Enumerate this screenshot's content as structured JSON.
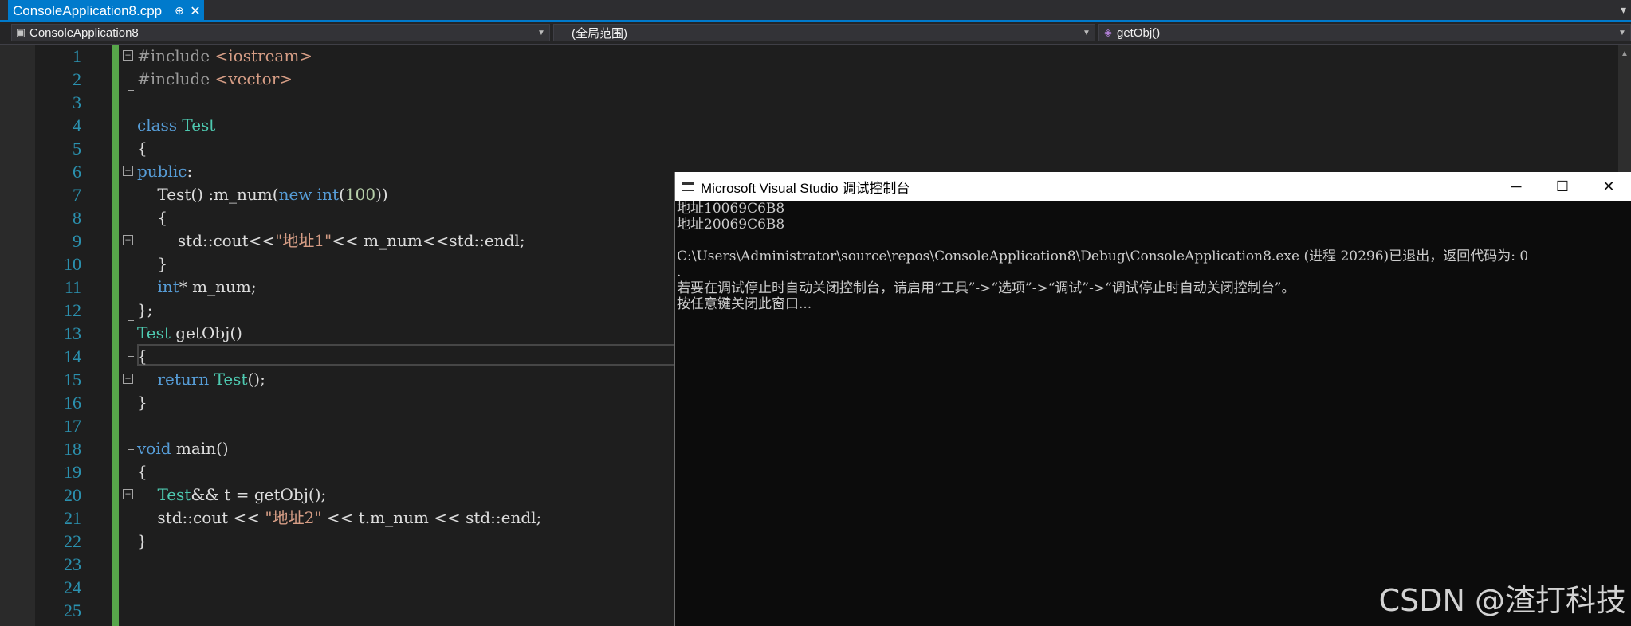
{
  "tabs": [
    {
      "title": "ConsoleApplication8.cpp",
      "pin_glyph": "⊕",
      "close_glyph": "✕"
    }
  ],
  "nav": {
    "project": "ConsoleApplication8",
    "scope": "(全局范围)",
    "member": "getObj()"
  },
  "editor": {
    "line_numbers": [
      "1",
      "2",
      "3",
      "4",
      "5",
      "6",
      "7",
      "8",
      "9",
      "10",
      "11",
      "12",
      "13",
      "14",
      "15",
      "16",
      "17",
      "18",
      "19",
      "20",
      "21",
      "22",
      "23",
      "24",
      "25"
    ],
    "lines": [
      [
        {
          "t": "#include ",
          "c": "pp"
        },
        {
          "t": "<iostream>",
          "c": "inc"
        }
      ],
      [
        {
          "t": "#include ",
          "c": "pp"
        },
        {
          "t": "<vector>",
          "c": "inc"
        }
      ],
      [],
      [
        {
          "t": "class ",
          "c": "kw"
        },
        {
          "t": "Test",
          "c": "ty"
        }
      ],
      [
        {
          "t": "{",
          "c": ""
        }
      ],
      [
        {
          "t": "public",
          "c": "kw"
        },
        {
          "t": ":",
          "c": ""
        }
      ],
      [
        {
          "t": "    Test() :m_num(",
          "c": ""
        },
        {
          "t": "new ",
          "c": "kw"
        },
        {
          "t": "int",
          "c": "kw"
        },
        {
          "t": "(",
          "c": ""
        },
        {
          "t": "100",
          "c": "num"
        },
        {
          "t": "))",
          "c": ""
        }
      ],
      [
        {
          "t": "    {",
          "c": ""
        }
      ],
      [
        {
          "t": "        std::cout<<",
          "c": ""
        },
        {
          "t": "\"地址1\"",
          "c": "str"
        },
        {
          "t": "<< m_num<<std::endl;",
          "c": ""
        }
      ],
      [
        {
          "t": "    }",
          "c": ""
        }
      ],
      [
        {
          "t": "    ",
          "c": ""
        },
        {
          "t": "int",
          "c": "kw"
        },
        {
          "t": "* m_num;",
          "c": ""
        }
      ],
      [
        {
          "t": "};",
          "c": ""
        }
      ],
      [
        {
          "t": "Test",
          "c": "ty"
        },
        {
          "t": " getObj()",
          "c": ""
        }
      ],
      [
        {
          "t": "{",
          "c": ""
        }
      ],
      [
        {
          "t": "    ",
          "c": ""
        },
        {
          "t": "return ",
          "c": "kw"
        },
        {
          "t": "Test",
          "c": "ty"
        },
        {
          "t": "();",
          "c": ""
        }
      ],
      [
        {
          "t": "}",
          "c": ""
        }
      ],
      [],
      [
        {
          "t": "void ",
          "c": "kw"
        },
        {
          "t": "main()",
          "c": ""
        }
      ],
      [
        {
          "t": "{",
          "c": ""
        }
      ],
      [
        {
          "t": "    ",
          "c": ""
        },
        {
          "t": "Test",
          "c": "ty"
        },
        {
          "t": "&& t = getObj();",
          "c": ""
        }
      ],
      [
        {
          "t": "    std::cout << ",
          "c": ""
        },
        {
          "t": "\"地址2\"",
          "c": "str"
        },
        {
          "t": " << t.m_num << std::endl;",
          "c": ""
        }
      ],
      [
        {
          "t": "}",
          "c": ""
        }
      ],
      [],
      [],
      []
    ]
  },
  "console": {
    "title": "Microsoft Visual Studio 调试控制台",
    "minimize_glyph": "─",
    "maximize_glyph": "☐",
    "close_glyph": "✕",
    "output_lines": [
      "地址10069C6B8",
      "地址20069C6B8",
      "",
      "C:\\Users\\Administrator\\source\\repos\\ConsoleApplication8\\Debug\\ConsoleApplication8.exe (进程 20296)已退出，返回代码为: 0",
      ".",
      "若要在调试停止时自动关闭控制台，请启用“工具”->“选项”->“调试”->“调试停止时自动关闭控制台”。",
      "按任意键关闭此窗口..."
    ]
  },
  "watermark": "CSDN @渣打科技"
}
